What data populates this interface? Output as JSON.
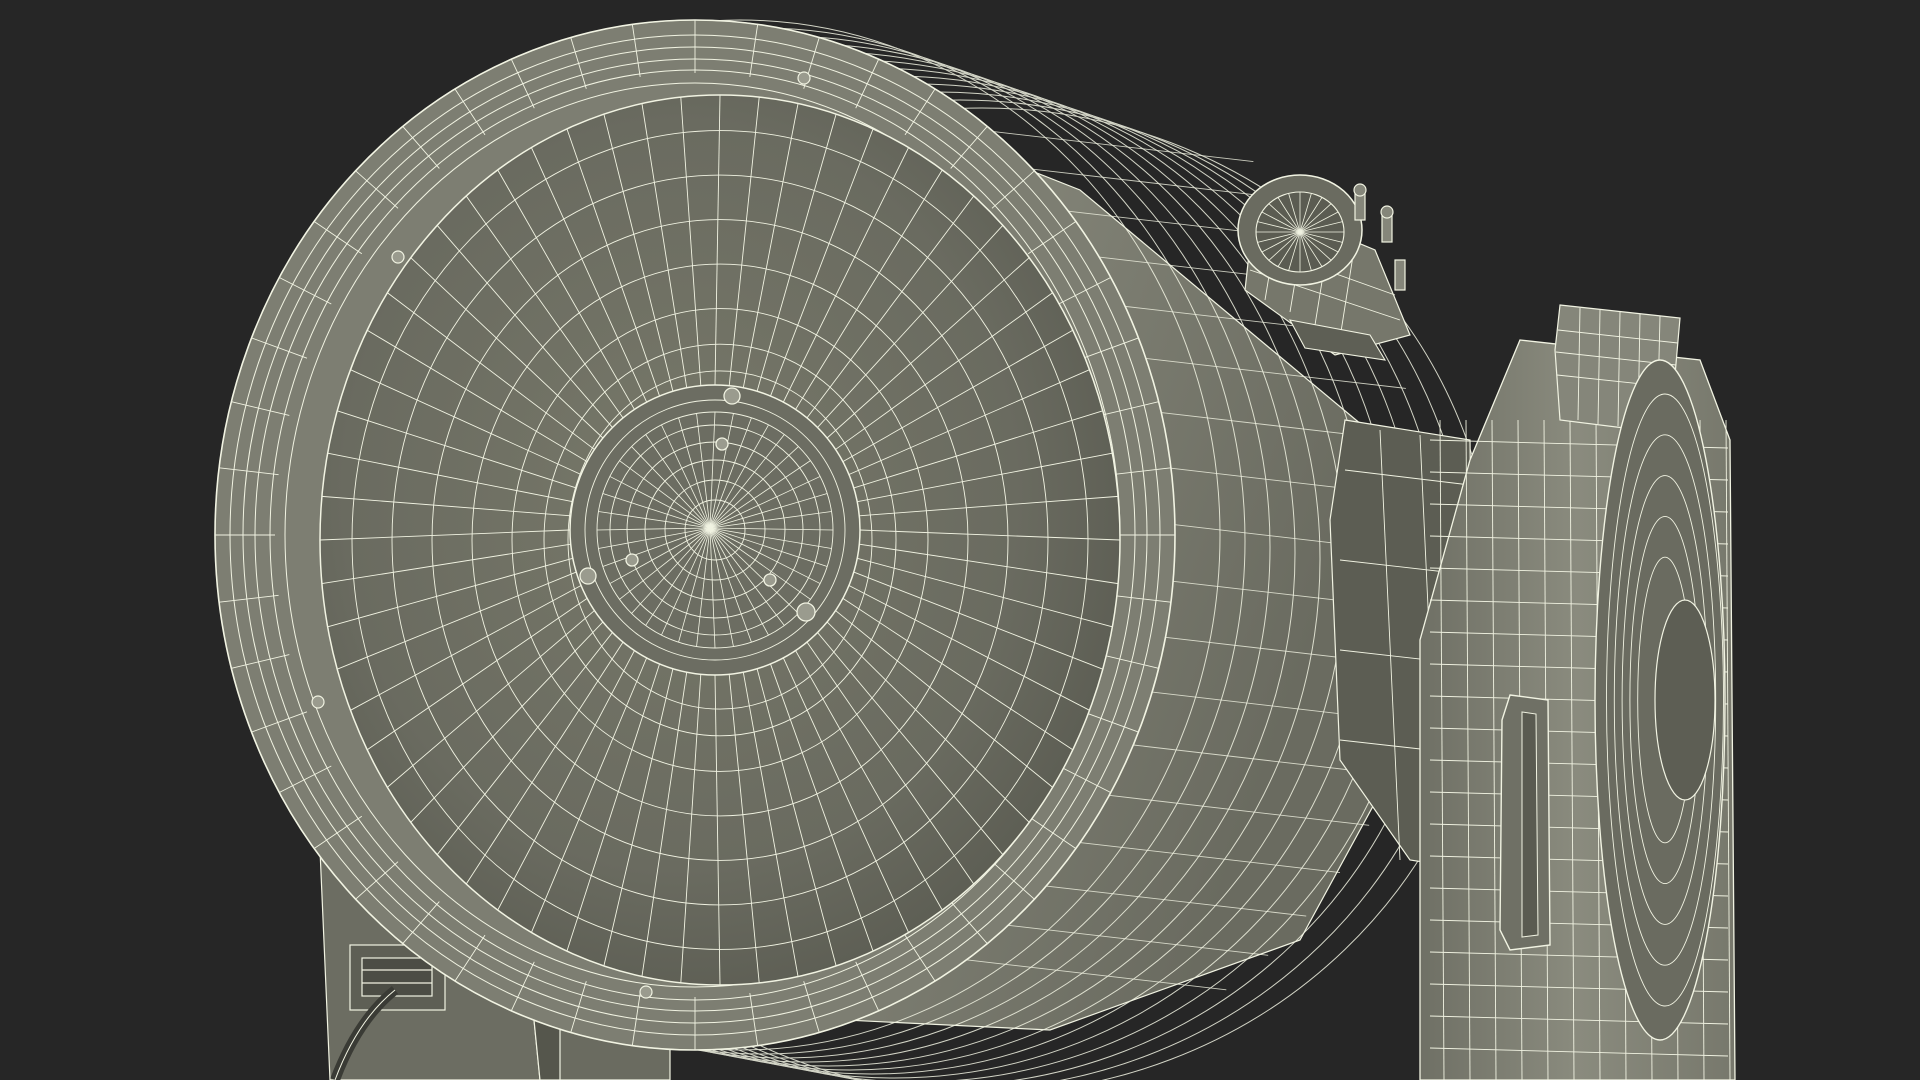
{
  "viewport": {
    "background_color": "#262626",
    "render_mode": "wireframe-on-shaded",
    "subject": "telescope-3d-model"
  },
  "colors": {
    "surface_light": "#86877a",
    "surface_mid": "#6f7065",
    "surface_dark": "#55564c",
    "surface_shadow": "#3d3e37",
    "wire": "#f1f3e2",
    "wire_dim": "#c9cbb8"
  }
}
